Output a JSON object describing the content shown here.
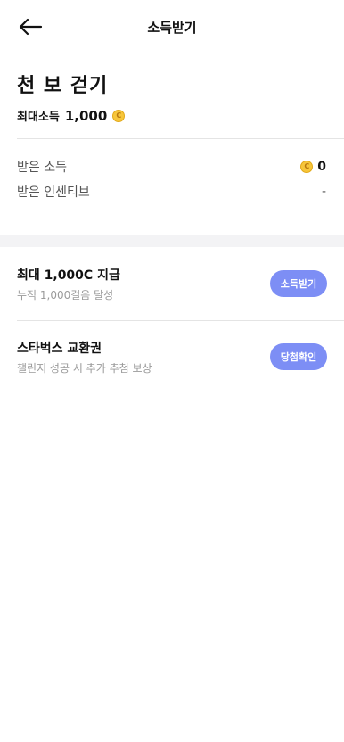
{
  "header": {
    "title": "소득받기",
    "back_icon": "arrow-left-icon"
  },
  "page": {
    "title": "천 보 걷기",
    "max_income_label": "최대소득",
    "max_income_value": "1,000"
  },
  "coin": {
    "symbol": "C",
    "icon": "coin-icon",
    "color": "#f7c63a"
  },
  "stats": {
    "received_income_label": "받은 소득",
    "received_income_value": "0",
    "received_incentive_label": "받은 인센티브",
    "received_incentive_value": "-"
  },
  "rewards": [
    {
      "title": "최대 1,000C 지급",
      "subtitle": "누적 1,000걸음 달성",
      "button": "소득받기"
    },
    {
      "title": "스타벅스 교환권",
      "subtitle": "챌린지 성공 시 추가 추첨 보상",
      "button": "당첨확인"
    }
  ],
  "colors": {
    "accent": "#7d8ef5",
    "band": "#f3f3f5"
  }
}
